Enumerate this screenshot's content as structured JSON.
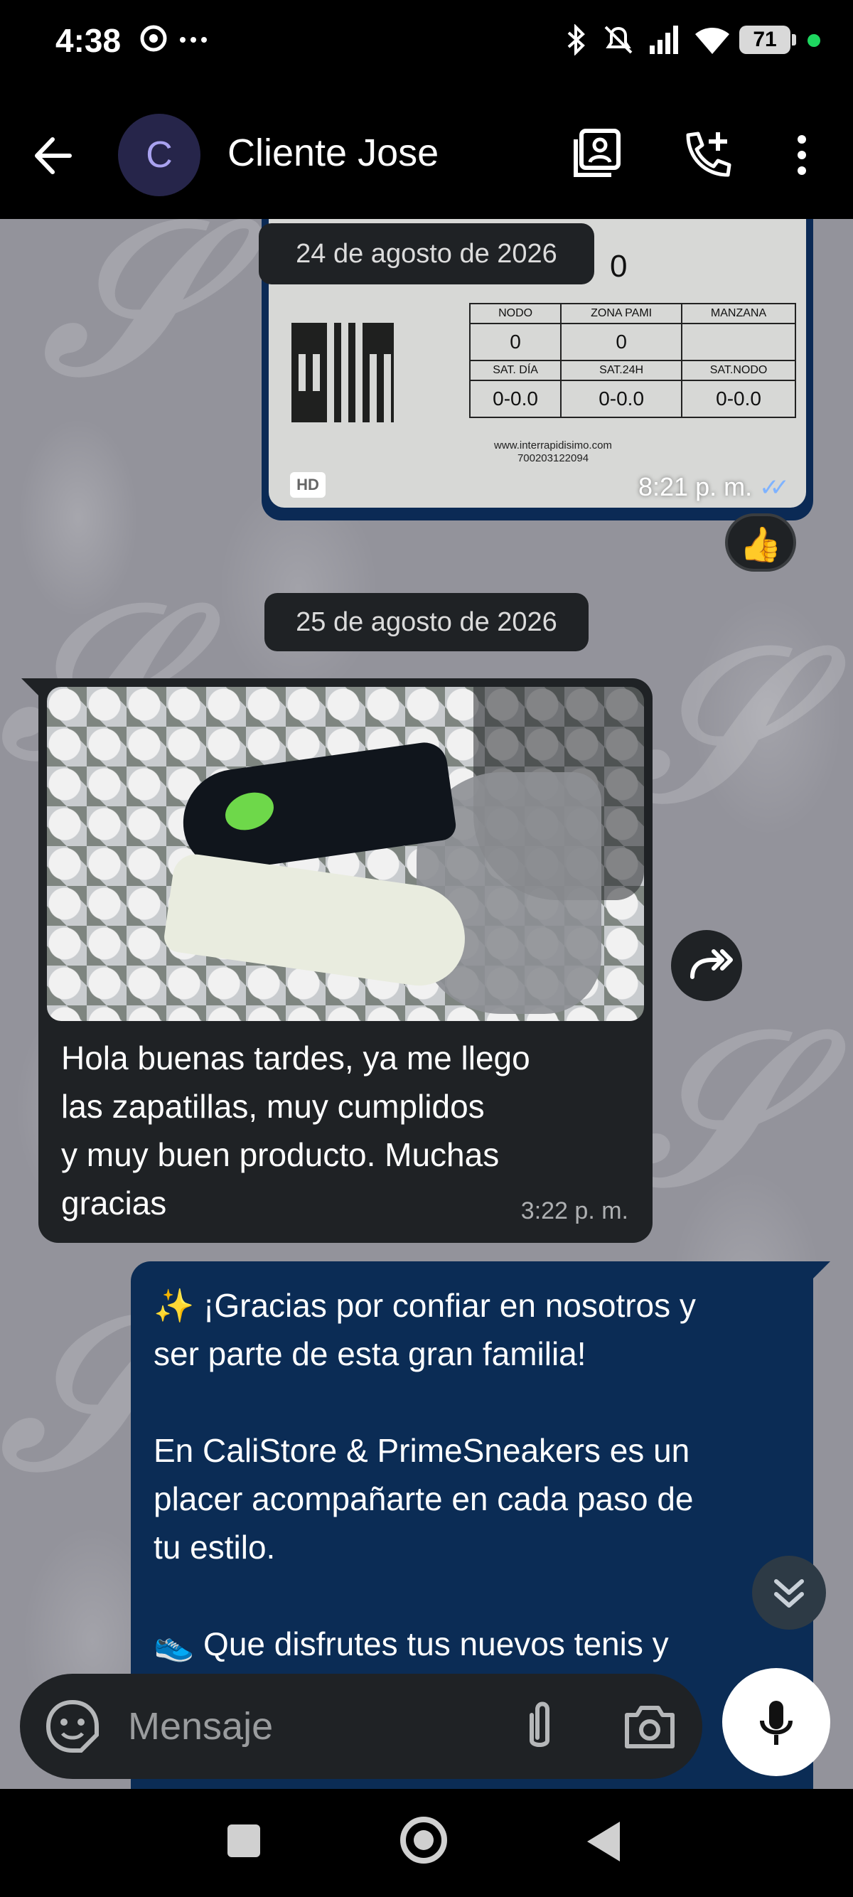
{
  "status_bar": {
    "time": "4:38",
    "battery": "71",
    "icons": [
      "chatgpt-icon",
      "more-icon",
      "bluetooth-icon",
      "mute-icon",
      "signal-icon",
      "wifi-icon",
      "battery-icon"
    ]
  },
  "header": {
    "avatar_letter": "C",
    "contact_name": "Cliente Jose",
    "actions": [
      "contact-card-icon",
      "add-call-icon",
      "more-vert-icon"
    ]
  },
  "messages": {
    "date_1": "24 de agosto de 2026",
    "shipping_label": {
      "big_zero": "0",
      "headers_row1": [
        "NODO",
        "ZONA PAMI",
        "MANZANA"
      ],
      "values_row1": [
        "0",
        "0",
        ""
      ],
      "headers_row2": [
        "SAT. DÍA",
        "SAT.24H",
        "SAT.NODO"
      ],
      "values_row2": [
        "0-0.0",
        "0-0.0",
        "0-0.0"
      ],
      "url": "www.interrapidisimo.com",
      "code": "700203122094"
    },
    "image_badge": "HD",
    "image_time": "8:21 p. m.",
    "image_ticks": "✓✓",
    "reaction": "👍",
    "date_2": "25 de agosto de 2026",
    "incoming_text": "Hola buenas tardes, ya me llego\nlas zapatillas, muy cumplidos\ny muy buen producto. Muchas\ngracias",
    "incoming_time": "3:22 p. m.",
    "outgoing_text": "✨ ¡Gracias por confiar en nosotros y\nser parte de esta gran familia!\n\nEn CaliStore & PrimeSneakers es un\nplacer acompañarte en cada paso de\ntu estilo.\n\n👟 Que disfrutes tus nuevos tenis y"
  },
  "composer": {
    "placeholder": "Mensaje"
  },
  "colors": {
    "outgoing_bubble": "#0b2c55",
    "incoming_bubble": "#1f2225",
    "accent_tick": "#7fb3ff"
  }
}
